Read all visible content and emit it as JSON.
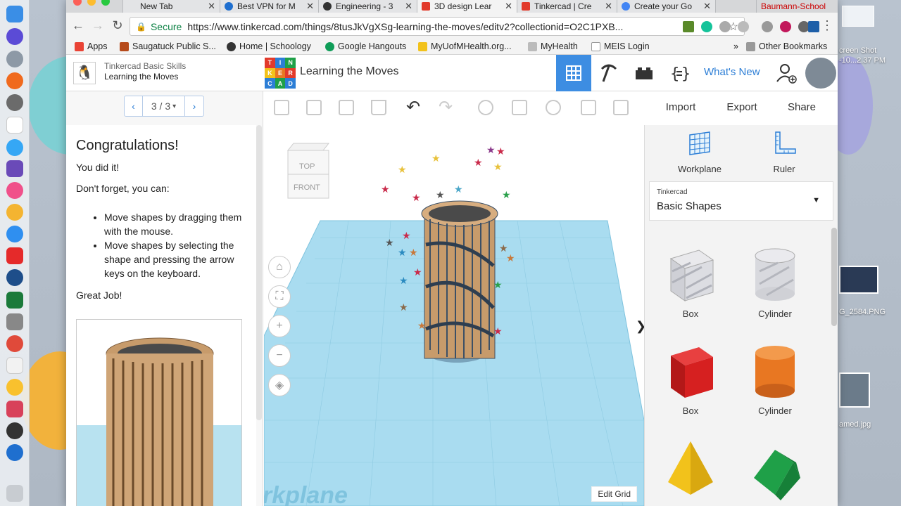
{
  "browser": {
    "tabs": [
      {
        "label": "New Tab",
        "favicon": "blank"
      },
      {
        "label": "Best VPN for M",
        "favicon": "vpn"
      },
      {
        "label": "Engineering - 3",
        "favicon": "schoology"
      },
      {
        "label": "3D design Lear",
        "favicon": "tinkercad"
      },
      {
        "label": "Tinkercad | Cre",
        "favicon": "tinkercad"
      },
      {
        "label": "Create your Go",
        "favicon": "google"
      }
    ],
    "active_tab_index": 3,
    "overflow_tab": "Baumann-School",
    "address": {
      "secure_label": "Secure",
      "url": "https://www.tinkercad.com/things/8tusJkVgXSg-learning-the-moves/editv2?collectionid=O2C1PXB..."
    },
    "bookmarks": [
      {
        "label": "Apps"
      },
      {
        "label": "Saugatuck Public S..."
      },
      {
        "label": "Home | Schoology"
      },
      {
        "label": "Google Hangouts"
      },
      {
        "label": "MyUofMHealth.org..."
      },
      {
        "label": "MyHealth"
      },
      {
        "label": "MEIS Login"
      }
    ],
    "bookmarks_overflow": "»",
    "other_bookmarks": "Other Bookmarks"
  },
  "desktop": {
    "files": [
      {
        "label": "creen Shot"
      },
      {
        "label": "-10...2.37 PM"
      },
      {
        "label": "G_2584.PNG"
      },
      {
        "label": "amed.jpg"
      }
    ]
  },
  "app": {
    "lesson": {
      "course": "Tinkercad Basic Skills",
      "title": "Learning the Moves",
      "pager": {
        "prev": "‹",
        "current": "3 / 3",
        "caret": "▾",
        "next": "›"
      },
      "heading": "Congratulations!",
      "line1": "You did it!",
      "line2": "Don't forget, you can:",
      "bullets": [
        "Move shapes by dragging them with the mouse.",
        "Move shapes by selecting the shape and pressing the arrow keys on the keyboard."
      ],
      "closing": "Great Job!"
    },
    "design_title": "Learning the Moves",
    "logo_letters": [
      "T",
      "I",
      "N",
      "K",
      "E",
      "R",
      "C",
      "A",
      "D"
    ],
    "whats_new": "What's New",
    "actions": {
      "import": "Import",
      "export": "Export",
      "share": "Share"
    },
    "viewcube": {
      "top": "TOP",
      "front": "FRONT"
    },
    "workplane_watermark": "rkplane",
    "edit_grid": "Edit Grid",
    "right_panel": {
      "workplane_label": "Workplane",
      "ruler_label": "Ruler",
      "library_source": "Tinkercad",
      "library_name": "Basic Shapes",
      "shapes": [
        {
          "label": "Box",
          "style": "hole"
        },
        {
          "label": "Cylinder",
          "style": "hole"
        },
        {
          "label": "Box",
          "style": "solid",
          "color": "#d62020"
        },
        {
          "label": "Cylinder",
          "style": "solid",
          "color": "#e87722"
        },
        {
          "label": "",
          "style": "solid",
          "color": "#f2c21b"
        },
        {
          "label": "",
          "style": "solid",
          "color": "#1fa048"
        }
      ]
    },
    "colors": {
      "accent": "#3d8de2",
      "link": "#2c7ed6",
      "grid": "#a9dcf0"
    }
  }
}
